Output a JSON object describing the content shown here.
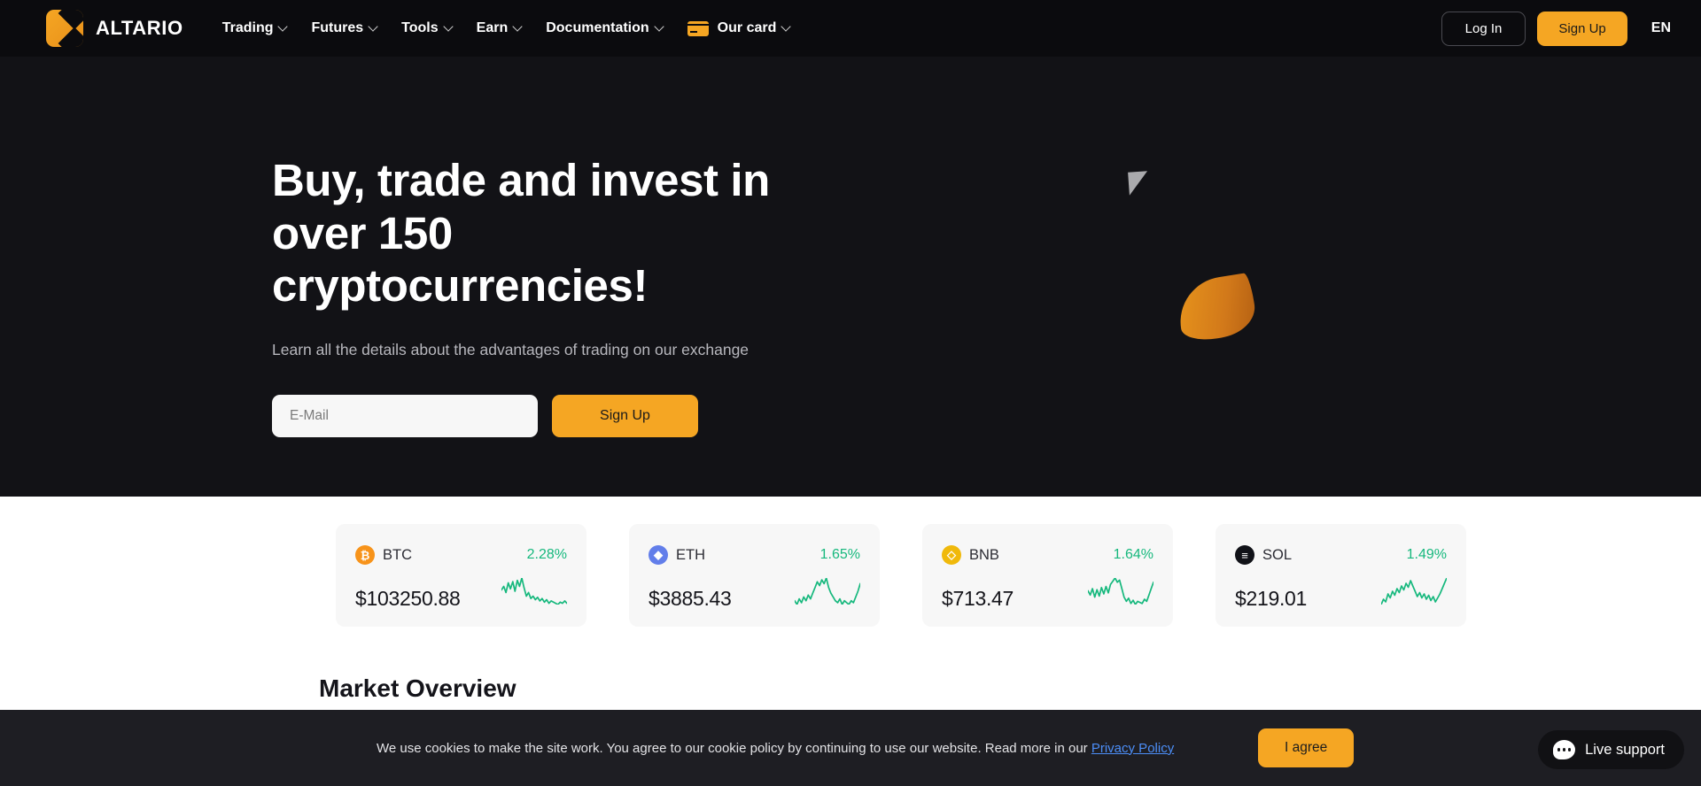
{
  "header": {
    "brand": "ALTARIO",
    "logo_icon": "altario-logo-icon",
    "nav": [
      {
        "label": "Trading",
        "has_dropdown": true,
        "icon": null
      },
      {
        "label": "Futures",
        "has_dropdown": true,
        "icon": null
      },
      {
        "label": "Tools",
        "has_dropdown": true,
        "icon": null
      },
      {
        "label": "Earn",
        "has_dropdown": true,
        "icon": null
      },
      {
        "label": "Documentation",
        "has_dropdown": true,
        "icon": null
      },
      {
        "label": "Our card",
        "has_dropdown": true,
        "icon": "credit-card-icon"
      }
    ],
    "login_label": "Log In",
    "signup_label": "Sign Up",
    "language": "EN"
  },
  "hero": {
    "title_line1": "Buy, trade and invest in",
    "title_line2": "over 150",
    "title_line3": "cryptocurrencies!",
    "subtitle": "Learn all the details about the advantages of trading on our exchange",
    "email_placeholder": "E-Mail",
    "email_value": "",
    "signup_label": "Sign Up"
  },
  "tickers": [
    {
      "symbol": "BTC",
      "glyph": "₿",
      "badge_color": "#f7931a",
      "price": "$103250.88",
      "change": "2.28%",
      "change_color": "#16b87d",
      "spark": [
        14,
        17,
        12,
        20,
        15,
        21,
        13,
        22,
        17,
        24,
        16,
        9,
        12,
        7,
        9,
        6,
        8,
        5,
        7,
        4,
        6,
        3,
        5,
        4,
        3,
        2,
        4,
        3,
        5,
        3
      ]
    },
    {
      "symbol": "ETH",
      "glyph": "◆",
      "badge_color": "#627eea",
      "price": "$3885.43",
      "change": "1.65%",
      "change_color": "#16b87d",
      "spark": [
        9,
        7,
        10,
        8,
        11,
        9,
        12,
        10,
        13,
        16,
        19,
        17,
        20,
        18,
        21,
        16,
        13,
        11,
        9,
        8,
        10,
        7,
        9,
        8,
        7,
        9,
        8,
        11,
        14,
        18
      ]
    },
    {
      "symbol": "BNB",
      "glyph": "◇",
      "badge_color": "#f0b90b",
      "price": "$713.47",
      "change": "1.64%",
      "change_color": "#16b87d",
      "spark": [
        16,
        12,
        18,
        10,
        17,
        11,
        19,
        13,
        20,
        14,
        22,
        25,
        28,
        24,
        26,
        18,
        10,
        6,
        9,
        4,
        7,
        3,
        6,
        5,
        4,
        8,
        6,
        12,
        18,
        24
      ]
    },
    {
      "symbol": "SOL",
      "glyph": "≡",
      "badge_color": "#111218",
      "price": "$219.01",
      "change": "1.49%",
      "change_color": "#16b87d",
      "spark": [
        6,
        10,
        8,
        14,
        11,
        16,
        13,
        18,
        15,
        20,
        17,
        22,
        19,
        24,
        20,
        16,
        12,
        15,
        11,
        14,
        10,
        13,
        9,
        12,
        8,
        11,
        14,
        18,
        22,
        26
      ]
    }
  ],
  "section": {
    "market_overview_title": "Market Overview"
  },
  "cookie": {
    "text_before": "We use cookies to make the site work. You agree to our cookie policy by continuing to use our website. Read more in our ",
    "link_label": "Privacy Policy",
    "agree_label": "I agree"
  },
  "live_support": {
    "label": "Live support",
    "icon": "chat-bubble-icon"
  },
  "colors": {
    "accent": "#f5a623",
    "hero_bg": "#121216",
    "header_bg": "#0b0b0e",
    "positive": "#16b87d",
    "link": "#4c8ef7"
  }
}
